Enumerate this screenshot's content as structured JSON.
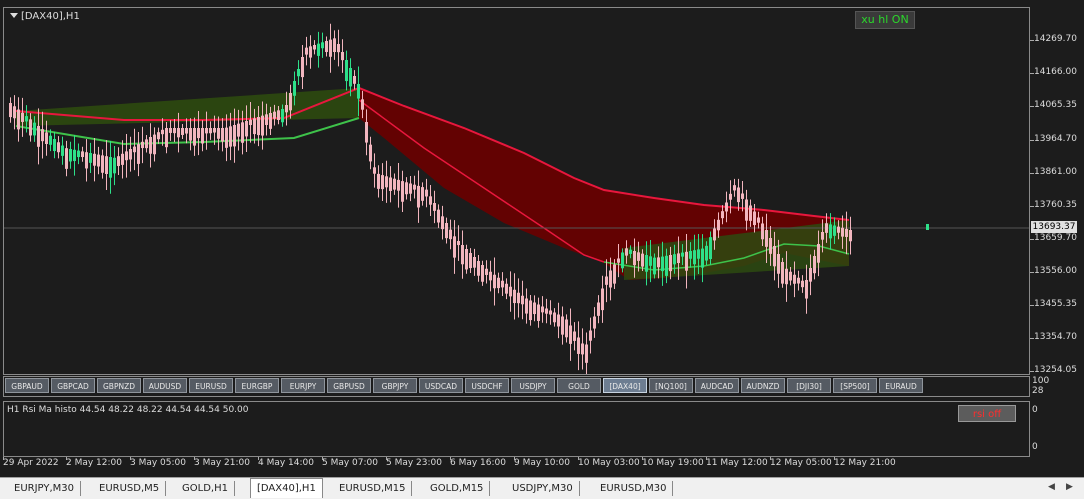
{
  "chart": {
    "title": "[DAX40],H1",
    "xuhl_button": "xu hl ON",
    "price_labels": [
      "14269.70",
      "14166.00",
      "14065.35",
      "13964.70",
      "13861.00",
      "13760.35",
      "13659.70",
      "13556.00",
      "13455.35",
      "13354.70",
      "13254.05"
    ],
    "current_price": "13693.37",
    "colors": {
      "bull_candle": "#2ee08a",
      "bear_candle": "#f2b6bf",
      "upper_band": "#e8173d",
      "lower_band": "#3ec24a",
      "bear_fill": "#6b0000",
      "bull_fill": "#2d4a10"
    }
  },
  "symbol_bar": {
    "buttons": [
      "GBPAUD",
      "GBPCAD",
      "GBPNZD",
      "AUDUSD",
      "EURUSD",
      "EURGBP",
      "EURJPY",
      "GBPUSD",
      "GBPJPY",
      "USDCAD",
      "USDCHF",
      "USDJPY",
      "GOLD",
      "[DAX40]",
      "[NQ100]",
      "AUDCAD",
      "AUDNZD",
      "[DJI30]",
      "[SP500]",
      "EURAUD"
    ],
    "active": "[DAX40]",
    "axis": [
      "100",
      "28"
    ]
  },
  "rsi": {
    "label": "H1 Rsi Ma histo 44.54 48.22 48.22 44.54 44.54 50.00",
    "button": "rsi off",
    "axis": [
      "0",
      "0"
    ]
  },
  "time_axis": [
    "29 Apr 2022",
    "2 May 12:00",
    "3 May 05:00",
    "3 May 21:00",
    "4 May 14:00",
    "5 May 07:00",
    "5 May 23:00",
    "6 May 16:00",
    "9 May 10:00",
    "10 May 03:00",
    "10 May 19:00",
    "11 May 12:00",
    "12 May 05:00",
    "12 May 21:00"
  ],
  "tabs": [
    "EURJPY,M30",
    "EURUSD,M5",
    "GOLD,H1",
    "[DAX40],H1",
    "EURUSD,M15",
    "GOLD,M15",
    "USDJPY,M30",
    "EURUSD,M30"
  ],
  "active_tab": "[DAX40],H1"
}
